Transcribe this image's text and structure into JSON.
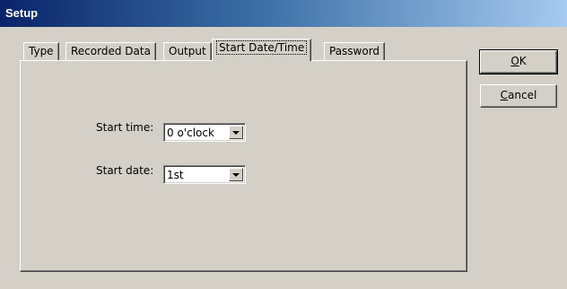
{
  "window": {
    "title": "Setup"
  },
  "tabs": [
    {
      "label": "Type"
    },
    {
      "label": "Recorded Data"
    },
    {
      "label": "Output"
    },
    {
      "label": "Start Date/Time"
    },
    {
      "label": "Password"
    }
  ],
  "active_tab": "Start Date/Time",
  "form": {
    "start_time": {
      "label": "Start time:",
      "value": "0 o'clock"
    },
    "start_date": {
      "label": "Start date:",
      "value": "1st"
    }
  },
  "buttons": {
    "ok": {
      "mnemonic": "O",
      "rest": "K"
    },
    "cancel": {
      "mnemonic": "C",
      "rest": "ancel"
    }
  }
}
